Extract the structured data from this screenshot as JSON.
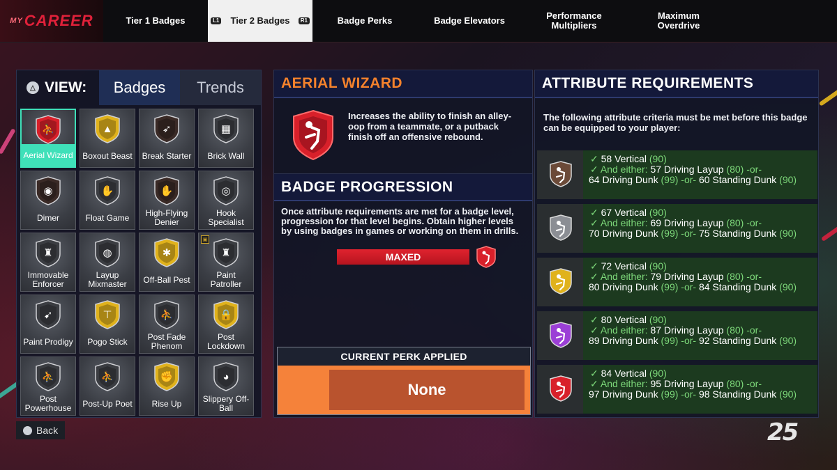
{
  "nav": {
    "logo_prefix": "MY",
    "logo": "CAREER",
    "tabs": [
      {
        "label": "Tier 1 Badges"
      },
      {
        "label": "Tier 2 Badges",
        "hint_left": "L1",
        "hint_right": "R1"
      },
      {
        "label": "Badge Perks"
      },
      {
        "label": "Badge Elevators"
      },
      {
        "label": "Performance Multipliers"
      },
      {
        "label": "Maximum Overdrive"
      }
    ]
  },
  "view": {
    "label": "VIEW:",
    "tabs": [
      "Badges",
      "Trends"
    ]
  },
  "badges": [
    {
      "name": "Aerial Wizard",
      "color": "#d8202a",
      "glyph": "⛹",
      "selected": true
    },
    {
      "name": "Boxout Beast",
      "color": "#e0b21c",
      "glyph": "▲"
    },
    {
      "name": "Break Starter",
      "color": "#3a2a26",
      "glyph": "➶"
    },
    {
      "name": "Brick Wall",
      "color": "#3b3d42",
      "glyph": "▦"
    },
    {
      "name": "Dimer",
      "color": "#3a2a26",
      "glyph": "◉"
    },
    {
      "name": "Float Game",
      "color": "#3b3d42",
      "glyph": "✋"
    },
    {
      "name": "High-Flying Denier",
      "color": "#3a2a26",
      "glyph": "✋"
    },
    {
      "name": "Hook Specialist",
      "color": "#3b3d42",
      "glyph": "◎"
    },
    {
      "name": "Immovable Enforcer",
      "color": "#3b3d42",
      "glyph": "♜"
    },
    {
      "name": "Layup Mixmaster",
      "color": "#3b3d42",
      "glyph": "◍"
    },
    {
      "name": "Off-Ball Pest",
      "color": "#e0b21c",
      "glyph": "✱"
    },
    {
      "name": "Paint Patroller",
      "color": "#3b3d42",
      "glyph": "♜",
      "new": true
    },
    {
      "name": "Paint Prodigy",
      "color": "#3b3d42",
      "glyph": "➹"
    },
    {
      "name": "Pogo Stick",
      "color": "#e0b21c",
      "glyph": "⊤"
    },
    {
      "name": "Post Fade Phenom",
      "color": "#3b3d42",
      "glyph": "⛹"
    },
    {
      "name": "Post Lockdown",
      "color": "#e0b21c",
      "glyph": "🔒"
    },
    {
      "name": "Post Powerhouse",
      "color": "#3b3d42",
      "glyph": "⛹"
    },
    {
      "name": "Post-Up Poet",
      "color": "#3b3d42",
      "glyph": "⛹"
    },
    {
      "name": "Rise Up",
      "color": "#e0b21c",
      "glyph": "✊"
    },
    {
      "name": "Slippery Off-Ball",
      "color": "#3b3d42",
      "glyph": "◕"
    }
  ],
  "back_label": "Back",
  "detail": {
    "title": "AERIAL WIZARD",
    "description": "Increases the ability to finish an alley-oop from a teammate, or a putback finish off an offensive rebound.",
    "progression_title": "BADGE PROGRESSION",
    "progression_text": "Once attribute requirements are met for a badge level, progression for that level begins. Obtain higher levels by using badges in games or working on them in drills.",
    "progress_label": "MAXED",
    "progress_fraction": 1.0,
    "perk_title": "CURRENT PERK APPLIED",
    "perk_value": "None"
  },
  "requirements": {
    "title": "ATTRIBUTE REQUIREMENTS",
    "intro": "The following attribute criteria must be met before this badge can be equipped to your player:",
    "levels": [
      {
        "color": "#6b4a38",
        "main": "58 Vertical",
        "main_req": "(90)",
        "layup": "57 Driving Layup",
        "layup_req": "(80)",
        "dunk": "64 Driving Dunk",
        "dunk_req": "(99)",
        "sdunk": "60 Standing Dunk",
        "sdunk_req": "(90)"
      },
      {
        "color": "#8b8e94",
        "main": "67 Vertical",
        "main_req": "(90)",
        "layup": "69 Driving Layup",
        "layup_req": "(80)",
        "dunk": "70 Driving Dunk",
        "dunk_req": "(99)",
        "sdunk": "75 Standing Dunk",
        "sdunk_req": "(90)"
      },
      {
        "color": "#e0b21c",
        "main": "72 Vertical",
        "main_req": "(90)",
        "layup": "79 Driving Layup",
        "layup_req": "(80)",
        "dunk": "80 Driving Dunk",
        "dunk_req": "(99)",
        "sdunk": "84 Standing Dunk",
        "sdunk_req": "(90)"
      },
      {
        "color": "#9b3fd6",
        "main": "80 Vertical",
        "main_req": "(90)",
        "layup": "87 Driving Layup",
        "layup_req": "(80)",
        "dunk": "89 Driving Dunk",
        "dunk_req": "(99)",
        "sdunk": "92 Standing Dunk",
        "sdunk_req": "(90)"
      },
      {
        "color": "#d8202a",
        "main": "84 Vertical",
        "main_req": "(90)",
        "layup": "95 Driving Layup",
        "layup_req": "(80)",
        "dunk": "97 Driving Dunk",
        "dunk_req": "(99)",
        "sdunk": "98 Standing Dunk",
        "sdunk_req": "(90)"
      }
    ],
    "either_label": "And either:",
    "or_label": "-or-",
    "check": "✓"
  },
  "brand": "2K25"
}
